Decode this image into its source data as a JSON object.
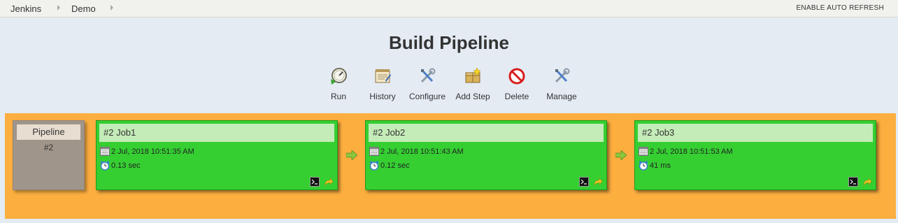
{
  "breadcrumb": {
    "items": [
      "Jenkins",
      "Demo"
    ],
    "auto_refresh": "ENABLE AUTO REFRESH"
  },
  "title": "Build Pipeline",
  "toolbar": {
    "run": "Run",
    "history": "History",
    "configure": "Configure",
    "add_step": "Add Step",
    "delete": "Delete",
    "manage": "Manage"
  },
  "pipeline": {
    "label": "Pipeline",
    "number": "#2",
    "jobs": [
      {
        "title": "#2 Job1",
        "date": "2 Jul, 2018 10:51:35 AM",
        "duration": "0.13 sec"
      },
      {
        "title": "#2 Job2",
        "date": "2 Jul, 2018 10:51:43 AM",
        "duration": "0.12 sec"
      },
      {
        "title": "#2 Job3",
        "date": "2 Jul, 2018 10:51:53 AM",
        "duration": "41 ms"
      }
    ]
  },
  "colors": {
    "background": "#e4ebf3",
    "pipeline_area": "#fcae3f",
    "job_success": "#35cf32",
    "job_header": "#c4ecb8",
    "pipeline_box": "#a0958a"
  },
  "icons": {
    "toolbar": [
      "run-icon",
      "history-icon",
      "configure-icon",
      "add-step-icon",
      "delete-icon",
      "manage-icon"
    ],
    "job": [
      "calendar-icon",
      "clock-icon",
      "console-icon",
      "rerun-icon"
    ],
    "flow": "arrow-right-icon"
  }
}
